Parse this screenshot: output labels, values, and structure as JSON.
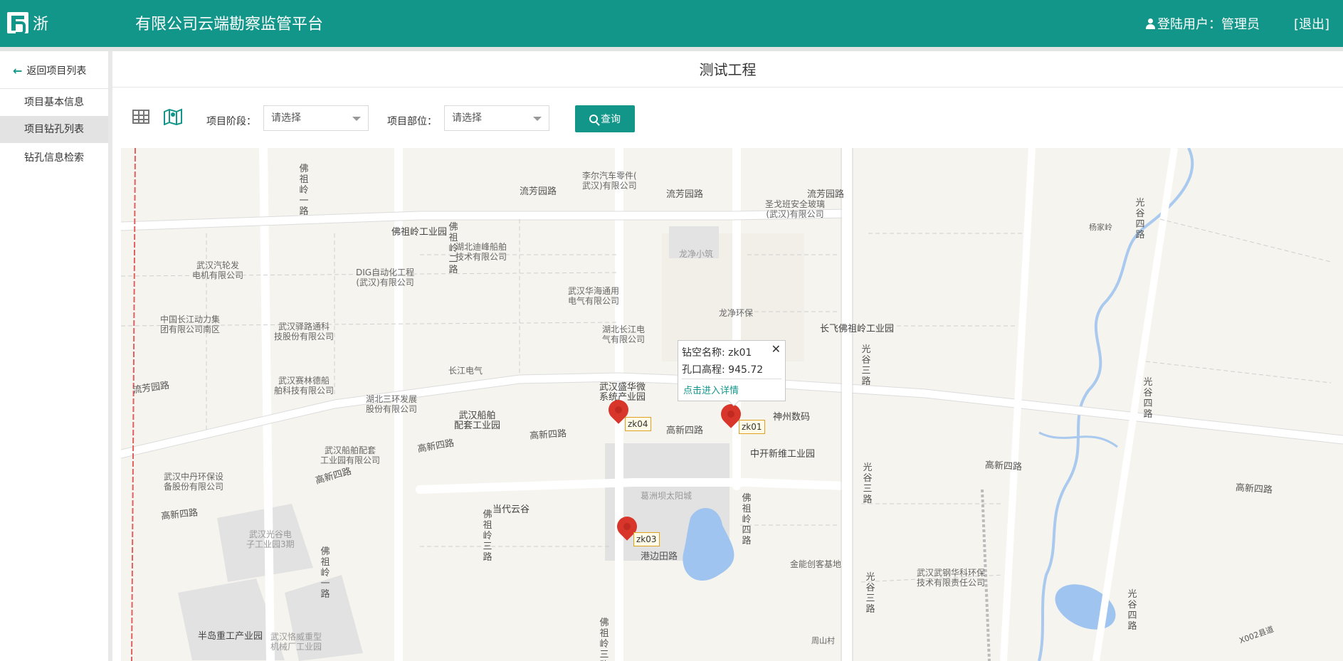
{
  "header": {
    "logo_text": "浙",
    "platform_title": "有限公司云端勘察监管平台",
    "user_label": "登陆用户：管理员",
    "logout_label": "[退出]",
    "brand_color": "#13968a"
  },
  "sidebar": {
    "back_label": "返回项目列表",
    "items": [
      {
        "label": "项目基本信息",
        "active": false
      },
      {
        "label": "项目钻孔列表",
        "active": true
      },
      {
        "label": "钻孔信息检索",
        "active": false
      }
    ]
  },
  "main": {
    "title": "测试工程",
    "stage_label": "项目阶段：",
    "stage_value": "请选择",
    "part_label": "项目部位：",
    "part_value": "请选择",
    "query_label": "查询"
  },
  "map": {
    "popup": {
      "name_line": "钻空名称: zk01",
      "elev_line": "孔口高程: 945.72",
      "link_label": "点击进入详情"
    },
    "markers": [
      "zk04",
      "zk01",
      "zk03"
    ],
    "pois": {
      "p1": "李尔汽车零件(\n武汉)有限公司",
      "p2": "圣戈班安全玻璃\n(武汉)有限公司",
      "p3": "佛祖岭工业园",
      "p4": "湖北迪峰船舶\n技术有限公司",
      "p5": "龙净小筑",
      "p6": "杨家岭",
      "p7": "武汉汽轮发\n电机有限公司",
      "p8": "DIG自动化工程\n(武汉)有限公司",
      "p9": "武汉华海通用\n电气有限公司",
      "p10": "龙净环保",
      "p11": "中国长江动力集\n团有限公司南区",
      "p12": "武汉驿路通科\n技股份有限公司",
      "p13": "湖北长江电\n气有限公司",
      "p14": "长飞佛祖岭工业园",
      "p15": "长江电气",
      "p16": "武汉赛林德船\n舶科技有限公司",
      "p17": "武汉盛华微\n系统产业园",
      "p18": "湖北三环发展\n股份有限公司",
      "p19": "神州数码",
      "p20": "武汉船舶\n配套工业园",
      "p21": "武汉船舶配套\n工业园有限公司",
      "p22": "中开新维工业园",
      "p23": "武汉中丹环保设\n备股份有限公司",
      "p24": "葛洲坝太阳城",
      "p25": "当代云谷",
      "p26": "武汉光谷电\n子工业园3期",
      "p27": "金能创客基地",
      "p28": "武汉武钢华科环保\n技术有限责任公司",
      "p29": "半岛重工产业园",
      "p30": "武汉恪威重型\n机械厂工业园",
      "p31": "周山村"
    },
    "roads": {
      "r1": "流芳园路",
      "r2": "流芳园路",
      "r3": "流芳园路",
      "r4": "流芳园路",
      "r5": "高新四路",
      "r6": "高新四路",
      "r7": "高新四路",
      "r8": "高新四路",
      "r9": "高新四路",
      "r10": "高新四路",
      "r11": "高新四路",
      "r12": "港边田路",
      "r13": "X002县道",
      "v1": "佛祖岭一路",
      "v2": "佛祖岭二路",
      "v3": "光谷三路",
      "v4": "光谷四路",
      "v5": "佛祖岭四路",
      "v6": "佛祖岭三路",
      "v7": "光谷三路",
      "v8": "光谷四路",
      "v9": "佛祖岭三路",
      "v10": "佛祖岭一路",
      "v11": "光谷四路",
      "v12": "光谷三路"
    }
  }
}
